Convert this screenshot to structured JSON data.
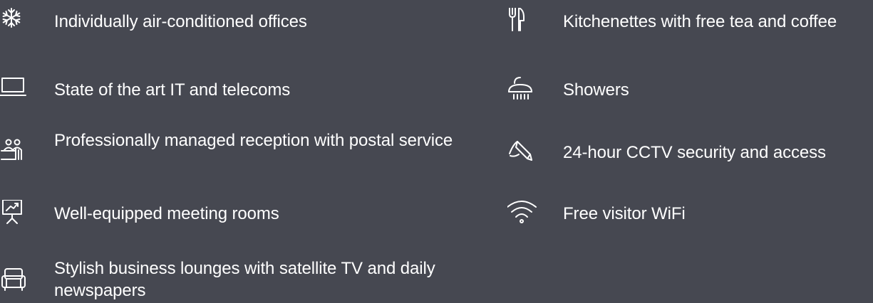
{
  "amenities": {
    "left": [
      {
        "icon": "snowflake-icon",
        "label": "Individually air-conditioned offices"
      },
      {
        "icon": "laptop-icon",
        "label": "State of the art IT and telecoms"
      },
      {
        "icon": "reception-desk-icon",
        "label": "Professionally managed reception with postal service"
      },
      {
        "icon": "presentation-board-icon",
        "label": "Well-equipped meeting rooms"
      },
      {
        "icon": "sofa-icon",
        "label": "Stylish business lounges with satellite TV and daily newspapers"
      }
    ],
    "right": [
      {
        "icon": "fork-knife-icon",
        "label": "Kitchenettes with free tea and coffee"
      },
      {
        "icon": "shower-icon",
        "label": "Showers"
      },
      {
        "icon": "cctv-camera-icon",
        "label": "24-hour CCTV security and access"
      },
      {
        "icon": "wifi-icon",
        "label": "Free  visitor WiFi"
      }
    ]
  },
  "colors": {
    "background": "#464851",
    "foreground": "#ffffff"
  }
}
